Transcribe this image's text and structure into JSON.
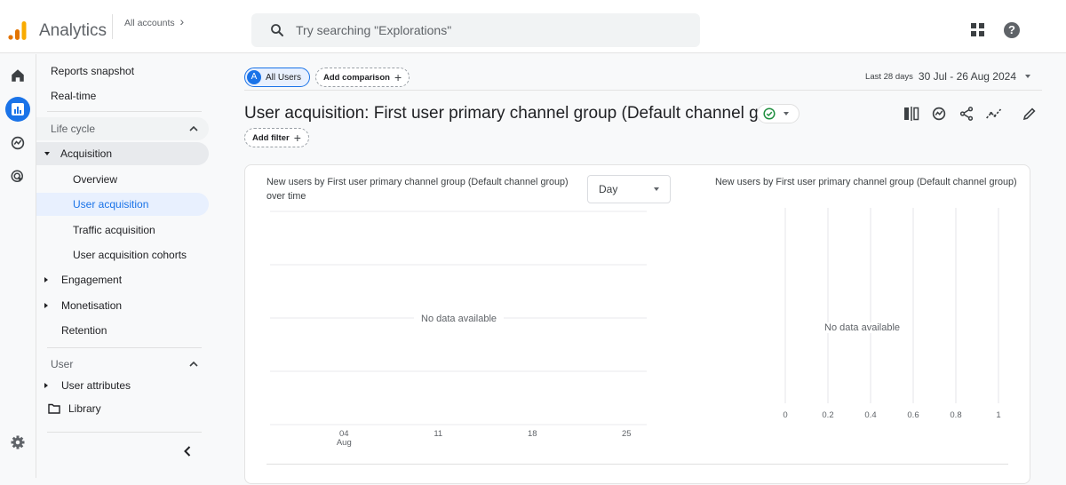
{
  "header": {
    "app_title": "Analytics",
    "all_accounts": "All accounts",
    "all_accounts_chevron": "›",
    "search_placeholder": "Try searching \"Explorations\"",
    "help": "?"
  },
  "colors": {
    "accent": "#1a73e8",
    "logo_orange": "#f9ab00",
    "logo_dark_orange": "#e37400",
    "success_green": "#1e8e3e"
  },
  "rail": {
    "items": [
      {
        "icon": "home-icon"
      },
      {
        "icon": "reports-icon",
        "active": true
      },
      {
        "icon": "explore-icon"
      },
      {
        "icon": "advertising-icon"
      },
      {
        "icon": "settings-icon"
      }
    ]
  },
  "sidebar": {
    "reports_snapshot": "Reports snapshot",
    "realtime": "Real-time",
    "lifecycle": "Life cycle",
    "acquisition": "Acquisition",
    "overview": "Overview",
    "user_acquisition": "User acquisition",
    "traffic_acquisition": "Traffic acquisition",
    "user_acquisition_cohorts": "User acquisition cohorts",
    "engagement": "Engagement",
    "monetisation": "Monetisation",
    "retention": "Retention",
    "user": "User",
    "user_attributes": "User attributes",
    "library": "Library",
    "collapse": "‹"
  },
  "main": {
    "segment_badge": "A",
    "segment_label": "All Users",
    "add_comparison": "Add comparison",
    "add_filter": "Add filter",
    "plus": "+",
    "date_label": "Last 28 days",
    "date_value": "30 Jul - 26 Aug 2024",
    "page_title": "User acquisition: First user primary channel group (Default channel group)",
    "toolbar": [
      "compare-icon",
      "insights-icon",
      "share-icon",
      "trend-icon",
      "edit-icon"
    ]
  },
  "chart_data": [
    {
      "type": "line",
      "title": "New users by First user primary channel group (Default channel group) over time",
      "granularity_select": "Day",
      "x_ticks": [
        {
          "label": "04",
          "sub": "Aug"
        },
        {
          "label": "11",
          "sub": ""
        },
        {
          "label": "18",
          "sub": ""
        },
        {
          "label": "25",
          "sub": ""
        }
      ],
      "series": [],
      "grid": true,
      "empty_message": "No data available"
    },
    {
      "type": "bar",
      "title": "New users by First user primary channel group (Default channel group)",
      "orientation": "horizontal",
      "x_ticks": [
        "0",
        "0.2",
        "0.4",
        "0.6",
        "0.8",
        "1"
      ],
      "xlim": [
        0,
        1
      ],
      "categories": [],
      "values": [],
      "grid": true,
      "empty_message": "No data available"
    }
  ]
}
